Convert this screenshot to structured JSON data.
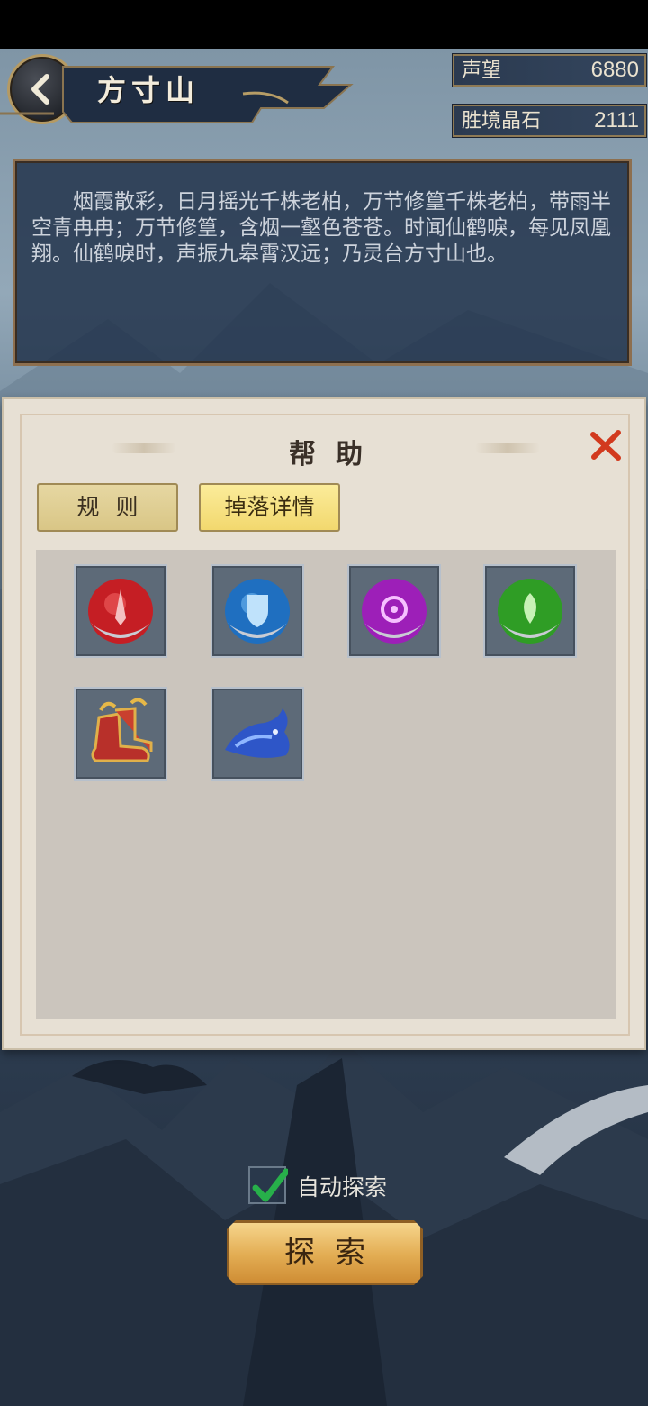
{
  "header": {
    "title": "方寸山",
    "back_icon": "back-arrow-icon"
  },
  "currencies": [
    {
      "label": "声望",
      "value": "6880"
    },
    {
      "label": "胜境晶石",
      "value": "2111"
    }
  ],
  "description": "烟霞散彩，日月摇光千株老柏，万节修篁千株老柏，带雨半空青冉冉；万节修篁，含烟一壑色苍苍。时闻仙鹤唳，每见凤凰翔。仙鹤唳时，声振九皋霄汉远；乃灵台方寸山也。",
  "help": {
    "title": "帮助",
    "tabs": [
      {
        "label": "规则",
        "active": false
      },
      {
        "label": "掉落详情",
        "active": true
      }
    ],
    "items": [
      {
        "name": "red-sword-orb-icon",
        "color": "#d8252b"
      },
      {
        "name": "blue-shield-orb-icon",
        "color": "#2c8ed8"
      },
      {
        "name": "purple-eye-orb-icon",
        "color": "#b42ad0"
      },
      {
        "name": "green-leaf-orb-icon",
        "color": "#33b52a"
      },
      {
        "name": "golden-boots-icon",
        "color": "#c8362a"
      },
      {
        "name": "blue-creature-icon",
        "color": "#3a66d6"
      }
    ]
  },
  "auto_explore": {
    "label": "自动探索",
    "checked": true
  },
  "explore_button": "探索",
  "colors": {
    "accent_gold": "#e2ac52",
    "tab_active": "#f2d86e",
    "close_red": "#d23a1e"
  }
}
